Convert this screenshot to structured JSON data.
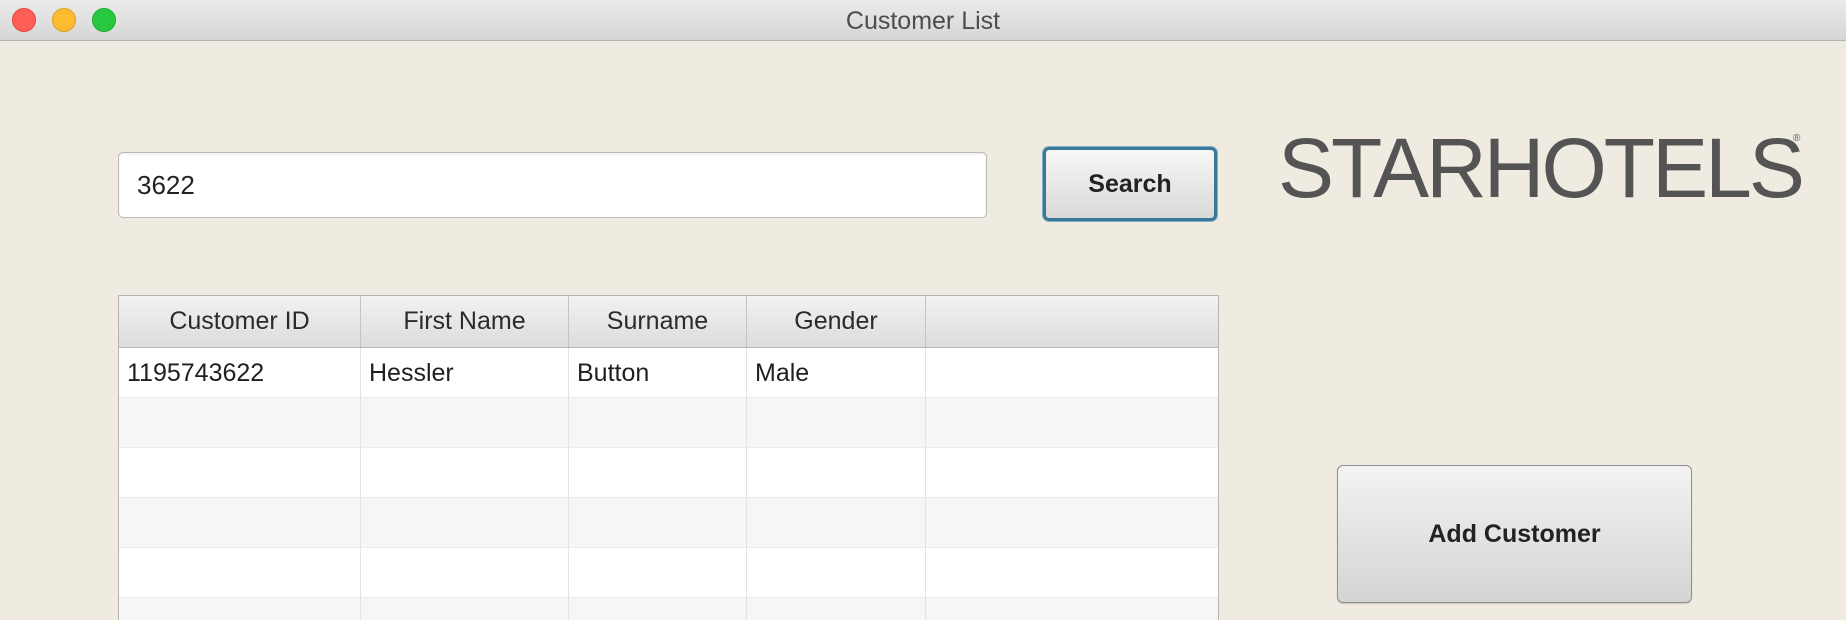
{
  "window": {
    "title": "Customer List"
  },
  "search": {
    "value": "3622",
    "button_label": "Search"
  },
  "logo": {
    "text": "STARHOTELS",
    "mark": "®"
  },
  "table": {
    "columns": [
      "Customer ID",
      "First Name",
      "Surname",
      "Gender",
      ""
    ],
    "rows": [
      [
        "1195743622",
        "Hessler",
        "Button",
        "Male",
        ""
      ],
      [
        "",
        "",
        "",
        "",
        ""
      ],
      [
        "",
        "",
        "",
        "",
        ""
      ],
      [
        "",
        "",
        "",
        "",
        ""
      ],
      [
        "",
        "",
        "",
        "",
        ""
      ],
      [
        "",
        "",
        "",
        "",
        ""
      ]
    ]
  },
  "actions": {
    "add_customer_label": "Add Customer"
  }
}
